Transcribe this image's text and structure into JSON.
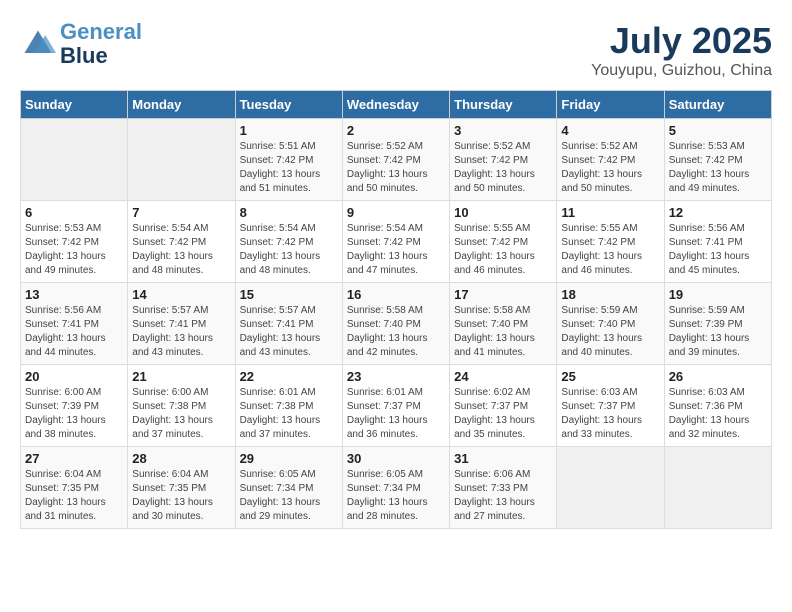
{
  "header": {
    "logo_line1": "General",
    "logo_line2": "Blue",
    "title": "July 2025",
    "subtitle": "Youyupu, Guizhou, China"
  },
  "days_of_week": [
    "Sunday",
    "Monday",
    "Tuesday",
    "Wednesday",
    "Thursday",
    "Friday",
    "Saturday"
  ],
  "weeks": [
    [
      {
        "day": "",
        "info": ""
      },
      {
        "day": "",
        "info": ""
      },
      {
        "day": "1",
        "info": "Sunrise: 5:51 AM\nSunset: 7:42 PM\nDaylight: 13 hours and 51 minutes."
      },
      {
        "day": "2",
        "info": "Sunrise: 5:52 AM\nSunset: 7:42 PM\nDaylight: 13 hours and 50 minutes."
      },
      {
        "day": "3",
        "info": "Sunrise: 5:52 AM\nSunset: 7:42 PM\nDaylight: 13 hours and 50 minutes."
      },
      {
        "day": "4",
        "info": "Sunrise: 5:52 AM\nSunset: 7:42 PM\nDaylight: 13 hours and 50 minutes."
      },
      {
        "day": "5",
        "info": "Sunrise: 5:53 AM\nSunset: 7:42 PM\nDaylight: 13 hours and 49 minutes."
      }
    ],
    [
      {
        "day": "6",
        "info": "Sunrise: 5:53 AM\nSunset: 7:42 PM\nDaylight: 13 hours and 49 minutes."
      },
      {
        "day": "7",
        "info": "Sunrise: 5:54 AM\nSunset: 7:42 PM\nDaylight: 13 hours and 48 minutes."
      },
      {
        "day": "8",
        "info": "Sunrise: 5:54 AM\nSunset: 7:42 PM\nDaylight: 13 hours and 48 minutes."
      },
      {
        "day": "9",
        "info": "Sunrise: 5:54 AM\nSunset: 7:42 PM\nDaylight: 13 hours and 47 minutes."
      },
      {
        "day": "10",
        "info": "Sunrise: 5:55 AM\nSunset: 7:42 PM\nDaylight: 13 hours and 46 minutes."
      },
      {
        "day": "11",
        "info": "Sunrise: 5:55 AM\nSunset: 7:42 PM\nDaylight: 13 hours and 46 minutes."
      },
      {
        "day": "12",
        "info": "Sunrise: 5:56 AM\nSunset: 7:41 PM\nDaylight: 13 hours and 45 minutes."
      }
    ],
    [
      {
        "day": "13",
        "info": "Sunrise: 5:56 AM\nSunset: 7:41 PM\nDaylight: 13 hours and 44 minutes."
      },
      {
        "day": "14",
        "info": "Sunrise: 5:57 AM\nSunset: 7:41 PM\nDaylight: 13 hours and 43 minutes."
      },
      {
        "day": "15",
        "info": "Sunrise: 5:57 AM\nSunset: 7:41 PM\nDaylight: 13 hours and 43 minutes."
      },
      {
        "day": "16",
        "info": "Sunrise: 5:58 AM\nSunset: 7:40 PM\nDaylight: 13 hours and 42 minutes."
      },
      {
        "day": "17",
        "info": "Sunrise: 5:58 AM\nSunset: 7:40 PM\nDaylight: 13 hours and 41 minutes."
      },
      {
        "day": "18",
        "info": "Sunrise: 5:59 AM\nSunset: 7:40 PM\nDaylight: 13 hours and 40 minutes."
      },
      {
        "day": "19",
        "info": "Sunrise: 5:59 AM\nSunset: 7:39 PM\nDaylight: 13 hours and 39 minutes."
      }
    ],
    [
      {
        "day": "20",
        "info": "Sunrise: 6:00 AM\nSunset: 7:39 PM\nDaylight: 13 hours and 38 minutes."
      },
      {
        "day": "21",
        "info": "Sunrise: 6:00 AM\nSunset: 7:38 PM\nDaylight: 13 hours and 37 minutes."
      },
      {
        "day": "22",
        "info": "Sunrise: 6:01 AM\nSunset: 7:38 PM\nDaylight: 13 hours and 37 minutes."
      },
      {
        "day": "23",
        "info": "Sunrise: 6:01 AM\nSunset: 7:37 PM\nDaylight: 13 hours and 36 minutes."
      },
      {
        "day": "24",
        "info": "Sunrise: 6:02 AM\nSunset: 7:37 PM\nDaylight: 13 hours and 35 minutes."
      },
      {
        "day": "25",
        "info": "Sunrise: 6:03 AM\nSunset: 7:37 PM\nDaylight: 13 hours and 33 minutes."
      },
      {
        "day": "26",
        "info": "Sunrise: 6:03 AM\nSunset: 7:36 PM\nDaylight: 13 hours and 32 minutes."
      }
    ],
    [
      {
        "day": "27",
        "info": "Sunrise: 6:04 AM\nSunset: 7:35 PM\nDaylight: 13 hours and 31 minutes."
      },
      {
        "day": "28",
        "info": "Sunrise: 6:04 AM\nSunset: 7:35 PM\nDaylight: 13 hours and 30 minutes."
      },
      {
        "day": "29",
        "info": "Sunrise: 6:05 AM\nSunset: 7:34 PM\nDaylight: 13 hours and 29 minutes."
      },
      {
        "day": "30",
        "info": "Sunrise: 6:05 AM\nSunset: 7:34 PM\nDaylight: 13 hours and 28 minutes."
      },
      {
        "day": "31",
        "info": "Sunrise: 6:06 AM\nSunset: 7:33 PM\nDaylight: 13 hours and 27 minutes."
      },
      {
        "day": "",
        "info": ""
      },
      {
        "day": "",
        "info": ""
      }
    ]
  ]
}
